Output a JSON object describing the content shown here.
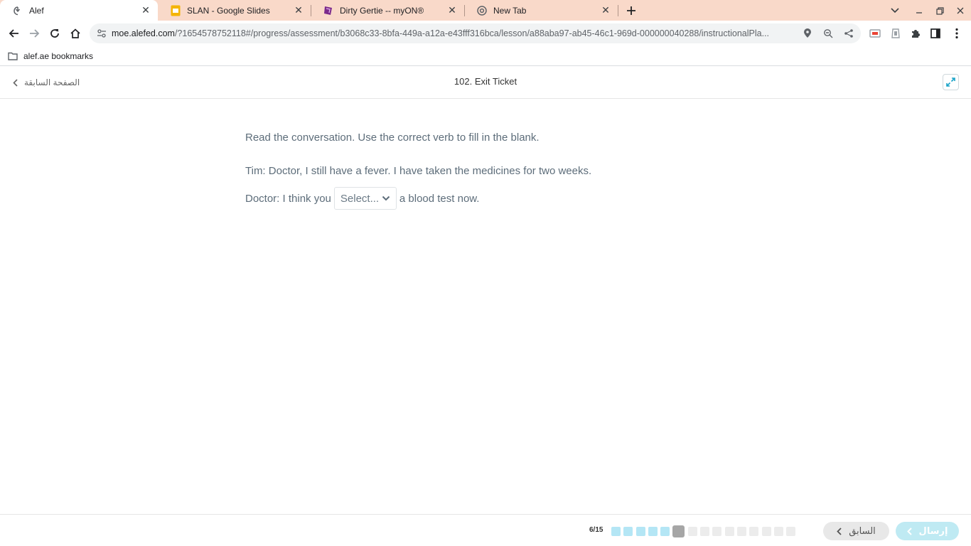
{
  "browser": {
    "tabs": [
      {
        "title": "Alef",
        "icon": "alef-icon",
        "active": true
      },
      {
        "title": "SLAN - Google Slides",
        "icon": "google-slides-icon",
        "active": false
      },
      {
        "title": "Dirty Gertie -- myON®",
        "icon": "myon-icon",
        "active": false
      },
      {
        "title": "New Tab",
        "icon": "chrome-icon",
        "active": false
      }
    ],
    "url_host": "moe.alefed.com",
    "url_rest": "/?1654578752118#/progress/assessment/b3068c33-8bfa-449a-a12a-e43fff316bca/lesson/a88aba97-ab45-46c1-969d-000000040288/instructionalPla...",
    "bookmark": "alef.ae bookmarks"
  },
  "header": {
    "back_label": "الصفحة السابقة",
    "title": "102. Exit Ticket"
  },
  "question": {
    "instruction": "Read the conversation. Use the correct verb to fill in the blank.",
    "line1": "Tim: Doctor, I still have a fever. I have taken the medicines for two weeks.",
    "line2_before": "Doctor: I think you",
    "select_placeholder": "Select...",
    "line2_after": "a blood test now."
  },
  "footer": {
    "progress_label": "6/15",
    "total_questions": 15,
    "current_question": 6,
    "prev_label": "السابق",
    "submit_label": "إرسال"
  },
  "colors": {
    "tabstrip": "#f9d9c9",
    "dot_done": "#b4e6f5",
    "dot_current": "#a6a6a6",
    "submit_bg": "#bfeaf3",
    "text": "#5d6d7a",
    "accent": "#1aa3c8"
  }
}
